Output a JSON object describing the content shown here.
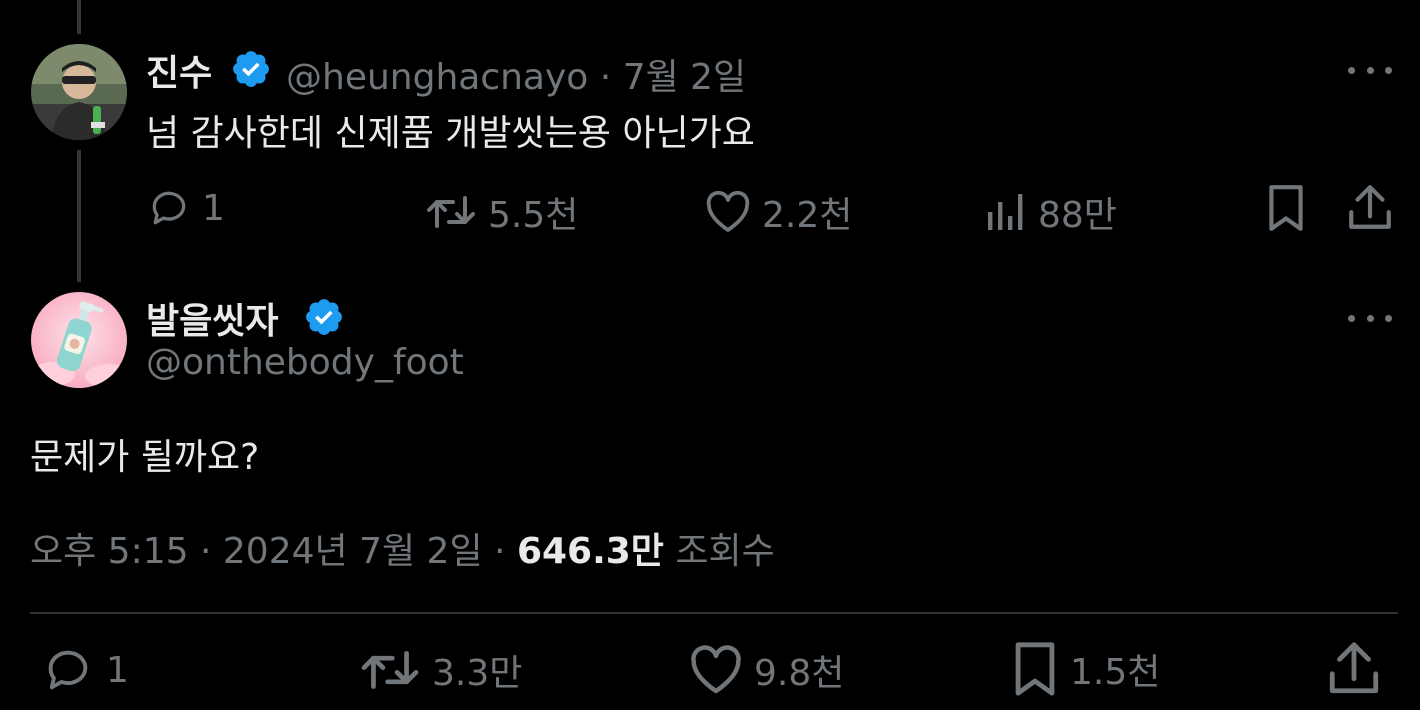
{
  "reply": {
    "display_name": "진수",
    "handle": "@heunghacnayo",
    "date_separator": "·",
    "date": "7월 2일",
    "text": "넘 감사한데 신제품 개발씻는용 아닌가요",
    "actions": {
      "replies": "1",
      "reposts": "5.5천",
      "likes": "2.2천",
      "views": "88만"
    }
  },
  "main": {
    "display_name": "발을씻자",
    "handle": "@onthebody_foot",
    "text": "문제가 될까요?",
    "timestamp": {
      "time": "오후 5:15",
      "sep1": "·",
      "date": "2024년 7월 2일",
      "sep2": "·",
      "views_count": "646.3만",
      "views_label": "조회수"
    },
    "actions": {
      "replies": "1",
      "reposts": "3.3만",
      "likes": "9.8천",
      "bookmarks": "1.5천"
    }
  },
  "colors": {
    "background": "#000000",
    "text_primary": "#e7e9ea",
    "text_muted": "#71767b",
    "verified_blue": "#1d9bf0"
  },
  "icons": [
    "verified-badge-icon",
    "more-icon",
    "reply-icon",
    "repost-icon",
    "like-icon",
    "views-icon",
    "bookmark-icon",
    "share-icon"
  ]
}
